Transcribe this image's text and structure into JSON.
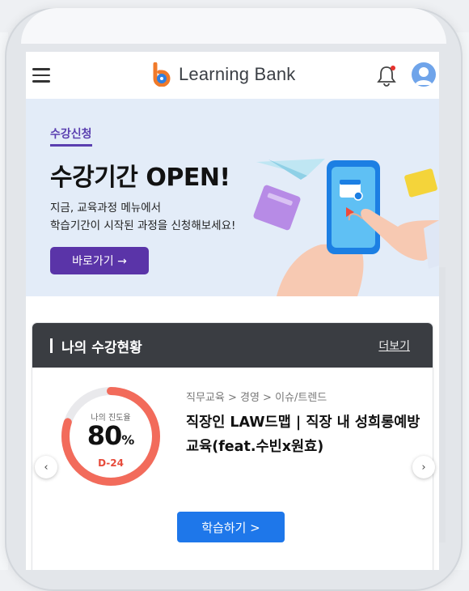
{
  "header": {
    "brand": "Learning Bank"
  },
  "banner": {
    "tag": "수강신청",
    "title": "수강기간 OPEN!",
    "desc_line1": "지금, 교육과정 메뉴에서",
    "desc_line2": "학습기간이 시작된 과정을 신청해보세요!",
    "button_label": "바로가기 →"
  },
  "status": {
    "title": "나의 수강현황",
    "more": "더보기",
    "progress_label": "나의 진도율",
    "progress_value": "80",
    "progress_unit": "%",
    "progress_fraction": 0.8,
    "dday": "D-24",
    "breadcrumb": "직무교육 > 경영 > 이슈/트렌드",
    "course_title": "직장인 LAW드맵 | 직장 내 성희롱예방교육(feat.수빈x원효)",
    "study_button": "학습하기 >"
  },
  "colors": {
    "brand_blue": "#1e77ea",
    "brand_orange": "#f07a2a",
    "banner_bg": "#e3ecf8",
    "banner_button": "#5a34a8",
    "progress": "#f26b5b",
    "header_dark": "#3a3d42"
  },
  "icons": {
    "menu": "hamburger-icon",
    "bell": "bell-icon",
    "avatar": "user-icon",
    "prev": "chevron-left-icon",
    "next": "chevron-right-icon"
  }
}
